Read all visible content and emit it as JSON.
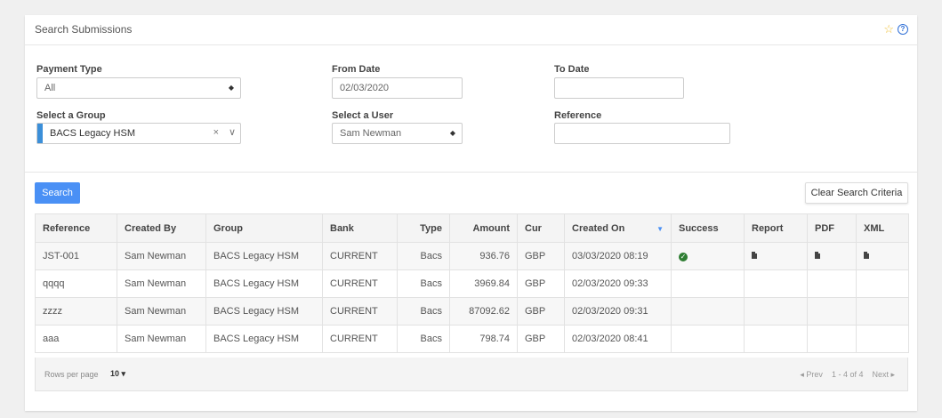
{
  "card": {
    "title": "Search Submissions"
  },
  "icons": {
    "star": "star-icon",
    "help": "help-icon"
  },
  "filters": {
    "payment_type": {
      "label": "Payment Type",
      "value": "All"
    },
    "from_date": {
      "label": "From Date",
      "value": "02/03/2020"
    },
    "to_date": {
      "label": "To Date",
      "value": ""
    },
    "group": {
      "label": "Select a Group",
      "value": "BACS Legacy HSM"
    },
    "user": {
      "label": "Select a User",
      "value": "Sam Newman"
    },
    "reference": {
      "label": "Reference",
      "value": ""
    }
  },
  "buttons": {
    "search": "Search",
    "clear": "Clear Search Criteria"
  },
  "table": {
    "columns": [
      "Reference",
      "Created By",
      "Group",
      "Bank",
      "Type",
      "Amount",
      "Cur",
      "Created On",
      "Success",
      "Report",
      "PDF",
      "XML"
    ],
    "rows": [
      {
        "reference": "JST-001",
        "created_by": "Sam Newman",
        "group": "BACS Legacy HSM",
        "bank": "CURRENT",
        "type": "Bacs",
        "amount": "936.76",
        "cur": "GBP",
        "created_on": "03/03/2020 08:19",
        "success": true,
        "report": true,
        "pdf": true,
        "xml": true
      },
      {
        "reference": "qqqq",
        "created_by": "Sam Newman",
        "group": "BACS Legacy HSM",
        "bank": "CURRENT",
        "type": "Bacs",
        "amount": "3969.84",
        "cur": "GBP",
        "created_on": "02/03/2020 09:33",
        "success": false,
        "report": false,
        "pdf": false,
        "xml": false
      },
      {
        "reference": "zzzz",
        "created_by": "Sam Newman",
        "group": "BACS Legacy HSM",
        "bank": "CURRENT",
        "type": "Bacs",
        "amount": "87092.62",
        "cur": "GBP",
        "created_on": "02/03/2020 09:31",
        "success": false,
        "report": false,
        "pdf": false,
        "xml": false
      },
      {
        "reference": "aaa",
        "created_by": "Sam Newman",
        "group": "BACS Legacy HSM",
        "bank": "CURRENT",
        "type": "Bacs",
        "amount": "798.74",
        "cur": "GBP",
        "created_on": "02/03/2020 08:41",
        "success": false,
        "report": false,
        "pdf": false,
        "xml": false
      }
    ]
  },
  "footer": {
    "rows_per_page_label": "Rows per page",
    "rows_per_page": "10 ▾",
    "prev": "◂ Prev",
    "range": "1 - 4 of 4",
    "next": "Next ▸"
  },
  "colors": {
    "accent": "#4a90f5",
    "success": "#2e7d32",
    "group_bar": "#3b8fd9"
  }
}
